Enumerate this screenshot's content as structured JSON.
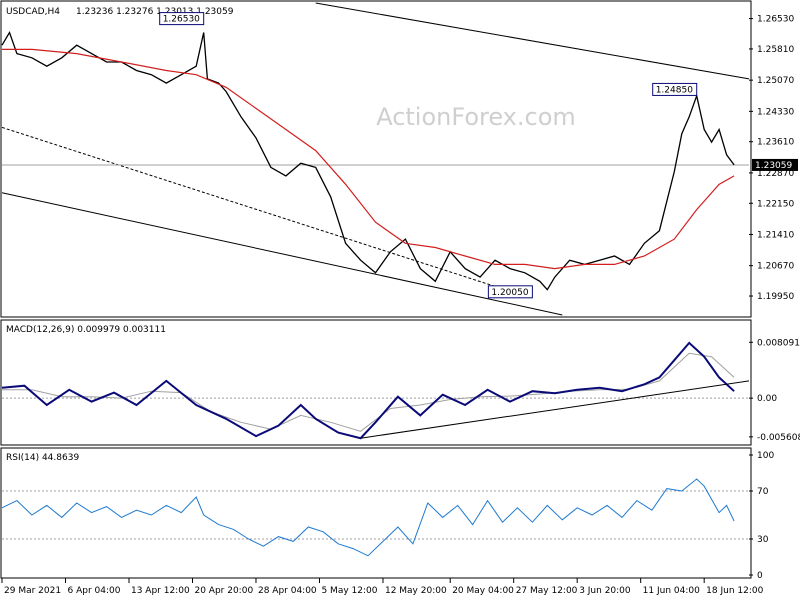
{
  "chart_data": {
    "type": "line",
    "symbol_header": "USDCAD,H4",
    "ohlc_header": "1.23236 1.23276 1.23013 1.23059",
    "watermark": "ActionForex.com",
    "colors": {
      "candle": "#000000",
      "sma": "#d21e1e",
      "macd": "#0a0a78",
      "macd_signal": "#a0a0a0",
      "rsi": "#1e7ad2",
      "annotation_border": "#0a0a78",
      "annotation_fill": "#ffffff",
      "price_marker_fill": "#000000",
      "price_marker_text": "#ffffff",
      "grid": "#a0a0a0"
    },
    "price_panel": {
      "ylim": [
        1.195,
        1.269
      ],
      "yticks": [
        "1.26530",
        "1.25810",
        "1.25070",
        "1.24330",
        "1.23610",
        "1.22870",
        "1.22150",
        "1.21410",
        "1.20670",
        "1.19950"
      ],
      "current_price": "1.23059",
      "current_price_value": 1.23059,
      "annotations": [
        {
          "label": "1.26530",
          "value": 1.2653,
          "x_index": 0.27
        },
        {
          "label": "1.24850",
          "value": 1.2485,
          "x_index": 0.93
        },
        {
          "label": "1.20050",
          "value": 1.2005,
          "x_index": 0.71
        }
      ],
      "close_path": [
        [
          0,
          1.259
        ],
        [
          0.01,
          1.262
        ],
        [
          0.02,
          1.257
        ],
        [
          0.04,
          1.256
        ],
        [
          0.06,
          1.254
        ],
        [
          0.08,
          1.256
        ],
        [
          0.1,
          1.259
        ],
        [
          0.12,
          1.257
        ],
        [
          0.14,
          1.255
        ],
        [
          0.16,
          1.255
        ],
        [
          0.18,
          1.253
        ],
        [
          0.2,
          1.252
        ],
        [
          0.22,
          1.25
        ],
        [
          0.24,
          1.252
        ],
        [
          0.26,
          1.254
        ],
        [
          0.27,
          1.262
        ],
        [
          0.275,
          1.251
        ],
        [
          0.29,
          1.25
        ],
        [
          0.3,
          1.248
        ],
        [
          0.32,
          1.242
        ],
        [
          0.34,
          1.237
        ],
        [
          0.36,
          1.23
        ],
        [
          0.38,
          1.228
        ],
        [
          0.4,
          1.231
        ],
        [
          0.42,
          1.23
        ],
        [
          0.44,
          1.223
        ],
        [
          0.46,
          1.212
        ],
        [
          0.48,
          1.208
        ],
        [
          0.5,
          1.205
        ],
        [
          0.52,
          1.21
        ],
        [
          0.54,
          1.213
        ],
        [
          0.56,
          1.206
        ],
        [
          0.58,
          1.203
        ],
        [
          0.6,
          1.21
        ],
        [
          0.62,
          1.206
        ],
        [
          0.64,
          1.204
        ],
        [
          0.66,
          1.208
        ],
        [
          0.68,
          1.206
        ],
        [
          0.7,
          1.205
        ],
        [
          0.72,
          1.203
        ],
        [
          0.73,
          1.201
        ],
        [
          0.74,
          1.204
        ],
        [
          0.76,
          1.208
        ],
        [
          0.78,
          1.207
        ],
        [
          0.8,
          1.208
        ],
        [
          0.82,
          1.209
        ],
        [
          0.84,
          1.207
        ],
        [
          0.86,
          1.212
        ],
        [
          0.88,
          1.215
        ],
        [
          0.9,
          1.229
        ],
        [
          0.91,
          1.238
        ],
        [
          0.92,
          1.242
        ],
        [
          0.93,
          1.247
        ],
        [
          0.94,
          1.239
        ],
        [
          0.95,
          1.236
        ],
        [
          0.96,
          1.239
        ],
        [
          0.97,
          1.233
        ],
        [
          0.98,
          1.2306
        ]
      ],
      "sma_path": [
        [
          0,
          1.258
        ],
        [
          0.04,
          1.258
        ],
        [
          0.1,
          1.257
        ],
        [
          0.16,
          1.255
        ],
        [
          0.22,
          1.253
        ],
        [
          0.26,
          1.252
        ],
        [
          0.3,
          1.249
        ],
        [
          0.34,
          1.244
        ],
        [
          0.38,
          1.239
        ],
        [
          0.42,
          1.234
        ],
        [
          0.46,
          1.226
        ],
        [
          0.5,
          1.217
        ],
        [
          0.54,
          1.212
        ],
        [
          0.58,
          1.211
        ],
        [
          0.62,
          1.209
        ],
        [
          0.66,
          1.207
        ],
        [
          0.7,
          1.207
        ],
        [
          0.74,
          1.206
        ],
        [
          0.78,
          1.207
        ],
        [
          0.82,
          1.207
        ],
        [
          0.86,
          1.209
        ],
        [
          0.9,
          1.213
        ],
        [
          0.93,
          1.22
        ],
        [
          0.96,
          1.226
        ],
        [
          0.98,
          1.228
        ]
      ],
      "channel_top": [
        [
          0.42,
          1.269
        ],
        [
          1.0,
          1.251
        ]
      ],
      "channel_bottom": [
        [
          0.0,
          1.224
        ],
        [
          0.75,
          1.195
        ]
      ],
      "dashed_line": [
        [
          0.0,
          1.2395
        ],
        [
          0.7,
          1.1995
        ]
      ]
    },
    "macd_panel": {
      "label": "MACD(12,26,9) 0.009979 0.003111",
      "ylim": [
        -0.0065,
        0.009
      ],
      "yticks": [
        "0.008091",
        "0.00",
        "-0.005608"
      ],
      "macd_path": [
        [
          0,
          0.0015
        ],
        [
          0.03,
          0.0018
        ],
        [
          0.06,
          -0.001
        ],
        [
          0.09,
          0.0012
        ],
        [
          0.12,
          -0.0005
        ],
        [
          0.15,
          0.0008
        ],
        [
          0.18,
          -0.001
        ],
        [
          0.22,
          0.0025
        ],
        [
          0.26,
          -0.001
        ],
        [
          0.3,
          -0.003
        ],
        [
          0.34,
          -0.0055
        ],
        [
          0.37,
          -0.004
        ],
        [
          0.4,
          -0.001
        ],
        [
          0.42,
          -0.003
        ],
        [
          0.45,
          -0.005
        ],
        [
          0.48,
          -0.0058
        ],
        [
          0.5,
          -0.0035
        ],
        [
          0.53,
          0.0002
        ],
        [
          0.56,
          -0.0025
        ],
        [
          0.59,
          0.0005
        ],
        [
          0.62,
          -0.001
        ],
        [
          0.65,
          0.0012
        ],
        [
          0.68,
          -0.0005
        ],
        [
          0.71,
          0.001
        ],
        [
          0.74,
          0.0007
        ],
        [
          0.77,
          0.0012
        ],
        [
          0.8,
          0.0015
        ],
        [
          0.83,
          0.001
        ],
        [
          0.86,
          0.002
        ],
        [
          0.88,
          0.003
        ],
        [
          0.9,
          0.0055
        ],
        [
          0.92,
          0.008
        ],
        [
          0.94,
          0.006
        ],
        [
          0.96,
          0.003
        ],
        [
          0.98,
          0.001
        ]
      ],
      "signal_path": [
        [
          0,
          0.0012
        ],
        [
          0.04,
          0.0012
        ],
        [
          0.08,
          0.0002
        ],
        [
          0.12,
          0.0002
        ],
        [
          0.16,
          0.0
        ],
        [
          0.2,
          0.001
        ],
        [
          0.24,
          0.0008
        ],
        [
          0.28,
          -0.002
        ],
        [
          0.32,
          -0.0035
        ],
        [
          0.36,
          -0.0045
        ],
        [
          0.4,
          -0.0025
        ],
        [
          0.44,
          -0.0035
        ],
        [
          0.48,
          -0.0048
        ],
        [
          0.52,
          -0.0015
        ],
        [
          0.56,
          -0.001
        ],
        [
          0.6,
          -0.0002
        ],
        [
          0.64,
          0.0002
        ],
        [
          0.68,
          0.0003
        ],
        [
          0.72,
          0.0006
        ],
        [
          0.76,
          0.001
        ],
        [
          0.8,
          0.0012
        ],
        [
          0.84,
          0.0013
        ],
        [
          0.88,
          0.0025
        ],
        [
          0.92,
          0.0065
        ],
        [
          0.95,
          0.006
        ],
        [
          0.98,
          0.003
        ]
      ],
      "trendline": [
        [
          0.48,
          -0.0058
        ],
        [
          1.0,
          0.0025
        ]
      ]
    },
    "rsi_panel": {
      "label": "RSI(14) 44.8639",
      "ylim": [
        0,
        100
      ],
      "yticks": [
        "100",
        "70",
        "30",
        "0"
      ],
      "levels": [
        70,
        30
      ],
      "rsi_path": [
        [
          0,
          56
        ],
        [
          0.02,
          62
        ],
        [
          0.04,
          50
        ],
        [
          0.06,
          58
        ],
        [
          0.08,
          48
        ],
        [
          0.1,
          60
        ],
        [
          0.12,
          52
        ],
        [
          0.14,
          57
        ],
        [
          0.16,
          48
        ],
        [
          0.18,
          54
        ],
        [
          0.2,
          50
        ],
        [
          0.22,
          58
        ],
        [
          0.24,
          52
        ],
        [
          0.26,
          65
        ],
        [
          0.27,
          50
        ],
        [
          0.29,
          42
        ],
        [
          0.31,
          38
        ],
        [
          0.33,
          30
        ],
        [
          0.35,
          24
        ],
        [
          0.37,
          32
        ],
        [
          0.39,
          28
        ],
        [
          0.41,
          40
        ],
        [
          0.43,
          36
        ],
        [
          0.45,
          26
        ],
        [
          0.47,
          22
        ],
        [
          0.49,
          16
        ],
        [
          0.51,
          28
        ],
        [
          0.53,
          40
        ],
        [
          0.55,
          26
        ],
        [
          0.57,
          60
        ],
        [
          0.59,
          48
        ],
        [
          0.61,
          58
        ],
        [
          0.63,
          42
        ],
        [
          0.65,
          62
        ],
        [
          0.67,
          44
        ],
        [
          0.69,
          56
        ],
        [
          0.71,
          44
        ],
        [
          0.73,
          58
        ],
        [
          0.75,
          46
        ],
        [
          0.77,
          56
        ],
        [
          0.79,
          50
        ],
        [
          0.81,
          58
        ],
        [
          0.83,
          48
        ],
        [
          0.85,
          62
        ],
        [
          0.87,
          54
        ],
        [
          0.89,
          72
        ],
        [
          0.91,
          70
        ],
        [
          0.93,
          80
        ],
        [
          0.94,
          74
        ],
        [
          0.96,
          52
        ],
        [
          0.97,
          58
        ],
        [
          0.98,
          45
        ]
      ]
    },
    "x_axis": {
      "labels": [
        "29 Mar 2021",
        "6 Apr 04:00",
        "13 Apr 12:00",
        "20 Apr 20:00",
        "28 Apr 04:00",
        "5 May 12:00",
        "12 May 20:00",
        "20 May 04:00",
        "27 May 12:00",
        "3 Jun 20:00",
        "11 Jun 04:00",
        "18 Jun 12:00"
      ],
      "positions": [
        0.0,
        0.085,
        0.17,
        0.255,
        0.34,
        0.425,
        0.51,
        0.6,
        0.685,
        0.77,
        0.855,
        0.94
      ]
    }
  }
}
